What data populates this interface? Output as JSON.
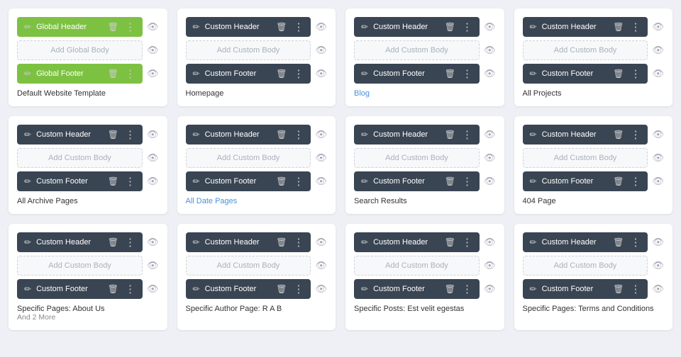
{
  "colors": {
    "green": "#7dc142",
    "dark": "#3a4553",
    "bodyBg": "#eef0f5",
    "cardBg": "#ffffff",
    "addBodyBorder": "#cdd2db",
    "addBodyBg": "#f7f8fa",
    "addBodyText": "#aab2bc",
    "eyeColor": "#9aa5b4",
    "linkColor": "#4a90d9"
  },
  "cards": [
    {
      "id": "default",
      "header": {
        "label": "Global Header",
        "style": "green"
      },
      "footer": {
        "label": "Global Footer",
        "style": "green"
      },
      "bodyLabel": "Add Global Body",
      "name": "Default Website Template",
      "nameStyle": "plain"
    },
    {
      "id": "homepage",
      "header": {
        "label": "Custom Header",
        "style": "dark"
      },
      "footer": {
        "label": "Custom Footer",
        "style": "dark"
      },
      "bodyLabel": "Add Custom Body",
      "name": "Homepage",
      "nameStyle": "plain"
    },
    {
      "id": "blog",
      "header": {
        "label": "Custom Header",
        "style": "dark"
      },
      "footer": {
        "label": "Custom Footer",
        "style": "dark"
      },
      "bodyLabel": "Add Custom Body",
      "name": "Blog",
      "nameStyle": "link"
    },
    {
      "id": "allprojects",
      "header": {
        "label": "Custom Header",
        "style": "dark"
      },
      "footer": {
        "label": "Custom Footer",
        "style": "dark"
      },
      "bodyLabel": "Add Custom Body",
      "name": "All Projects",
      "nameStyle": "plain"
    },
    {
      "id": "allarchive",
      "header": {
        "label": "Custom Header",
        "style": "dark"
      },
      "footer": {
        "label": "Custom Footer",
        "style": "dark"
      },
      "bodyLabel": "Add Custom Body",
      "name": "All Archive Pages",
      "nameStyle": "plain"
    },
    {
      "id": "alldate",
      "header": {
        "label": "Custom Header",
        "style": "dark"
      },
      "footer": {
        "label": "Custom Footer",
        "style": "dark"
      },
      "bodyLabel": "Add Custom Body",
      "name": "All Date Pages",
      "nameStyle": "link"
    },
    {
      "id": "search",
      "header": {
        "label": "Custom Header",
        "style": "dark"
      },
      "footer": {
        "label": "Custom Footer",
        "style": "dark"
      },
      "bodyLabel": "Add Custom Body",
      "name": "Search Results",
      "nameStyle": "plain"
    },
    {
      "id": "404",
      "header": {
        "label": "Custom Header",
        "style": "dark"
      },
      "footer": {
        "label": "Custom Footer",
        "style": "dark"
      },
      "bodyLabel": "Add Custom Body",
      "name": "404 Page",
      "nameStyle": "plain"
    },
    {
      "id": "aboutus",
      "header": {
        "label": "Custom Header",
        "style": "dark"
      },
      "footer": {
        "label": "Custom Footer",
        "style": "dark"
      },
      "bodyLabel": "Add Custom Body",
      "name": "Specific Pages: About Us",
      "sub": "And 2 More",
      "nameStyle": "plain"
    },
    {
      "id": "authorrab",
      "header": {
        "label": "Custom Header",
        "style": "dark"
      },
      "footer": {
        "label": "Custom Footer",
        "style": "dark"
      },
      "bodyLabel": "Add Custom Body",
      "name": "Specific Author Page: R A B",
      "nameStyle": "plain"
    },
    {
      "id": "specificposts",
      "header": {
        "label": "Custom Header",
        "style": "dark"
      },
      "footer": {
        "label": "Custom Footer",
        "style": "dark"
      },
      "bodyLabel": "Add Custom Body",
      "name": "Specific Posts: Est velit egestas",
      "nameStyle": "plain"
    },
    {
      "id": "termsandconditions",
      "header": {
        "label": "Custom Header",
        "style": "dark"
      },
      "footer": {
        "label": "Custom Footer",
        "style": "dark"
      },
      "bodyLabel": "Add Custom Body",
      "name": "Specific Pages: Terms and Conditions",
      "nameStyle": "plain"
    }
  ]
}
